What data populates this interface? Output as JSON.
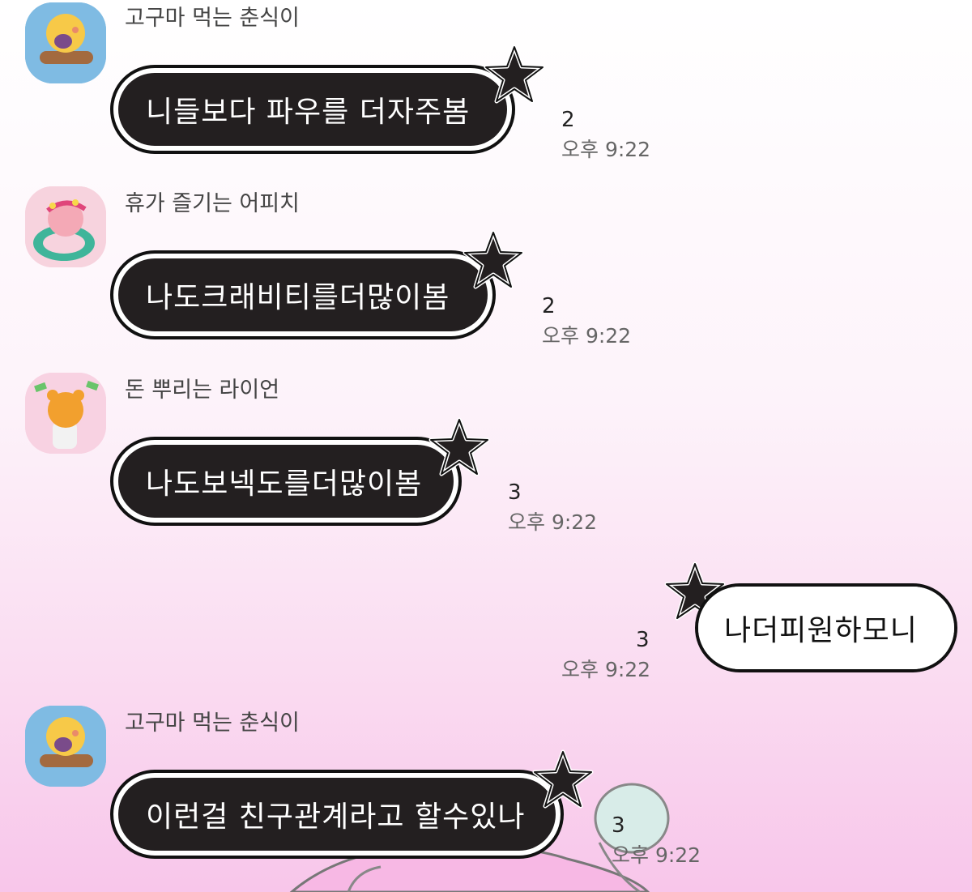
{
  "messages": [
    {
      "sender": "고구마 먹는 춘식이",
      "text": "니들보다 파우를 더자주봄",
      "unread": "2",
      "time": "오후 9:22",
      "avatar": "chunsik-sweet-potato-avatar"
    },
    {
      "sender": "휴가 즐기는 어피치",
      "text": "나도크래비티를더많이봄",
      "unread": "2",
      "time": "오후 9:22",
      "avatar": "apeach-vacation-avatar"
    },
    {
      "sender": "돈 뿌리는 라이언",
      "text": "나도보넥도를더많이봄",
      "unread": "3",
      "time": "오후 9:22",
      "avatar": "ryan-money-avatar"
    },
    {
      "sender": "",
      "text": "나더피원하모니",
      "unread": "3",
      "time": "오후 9:22",
      "mine": true
    },
    {
      "sender": "고구마 먹는 춘식이",
      "text": "이런걸 친구관계라고 할수있나",
      "unread": "3",
      "time": "오후 9:22",
      "avatar": "chunsik-sweet-potato-avatar"
    }
  ],
  "colors": {
    "bubble_dark": "#231f20",
    "bubble_outline": "#111111",
    "background_top": "#ffffff",
    "background_bottom": "#f8c6ea"
  }
}
